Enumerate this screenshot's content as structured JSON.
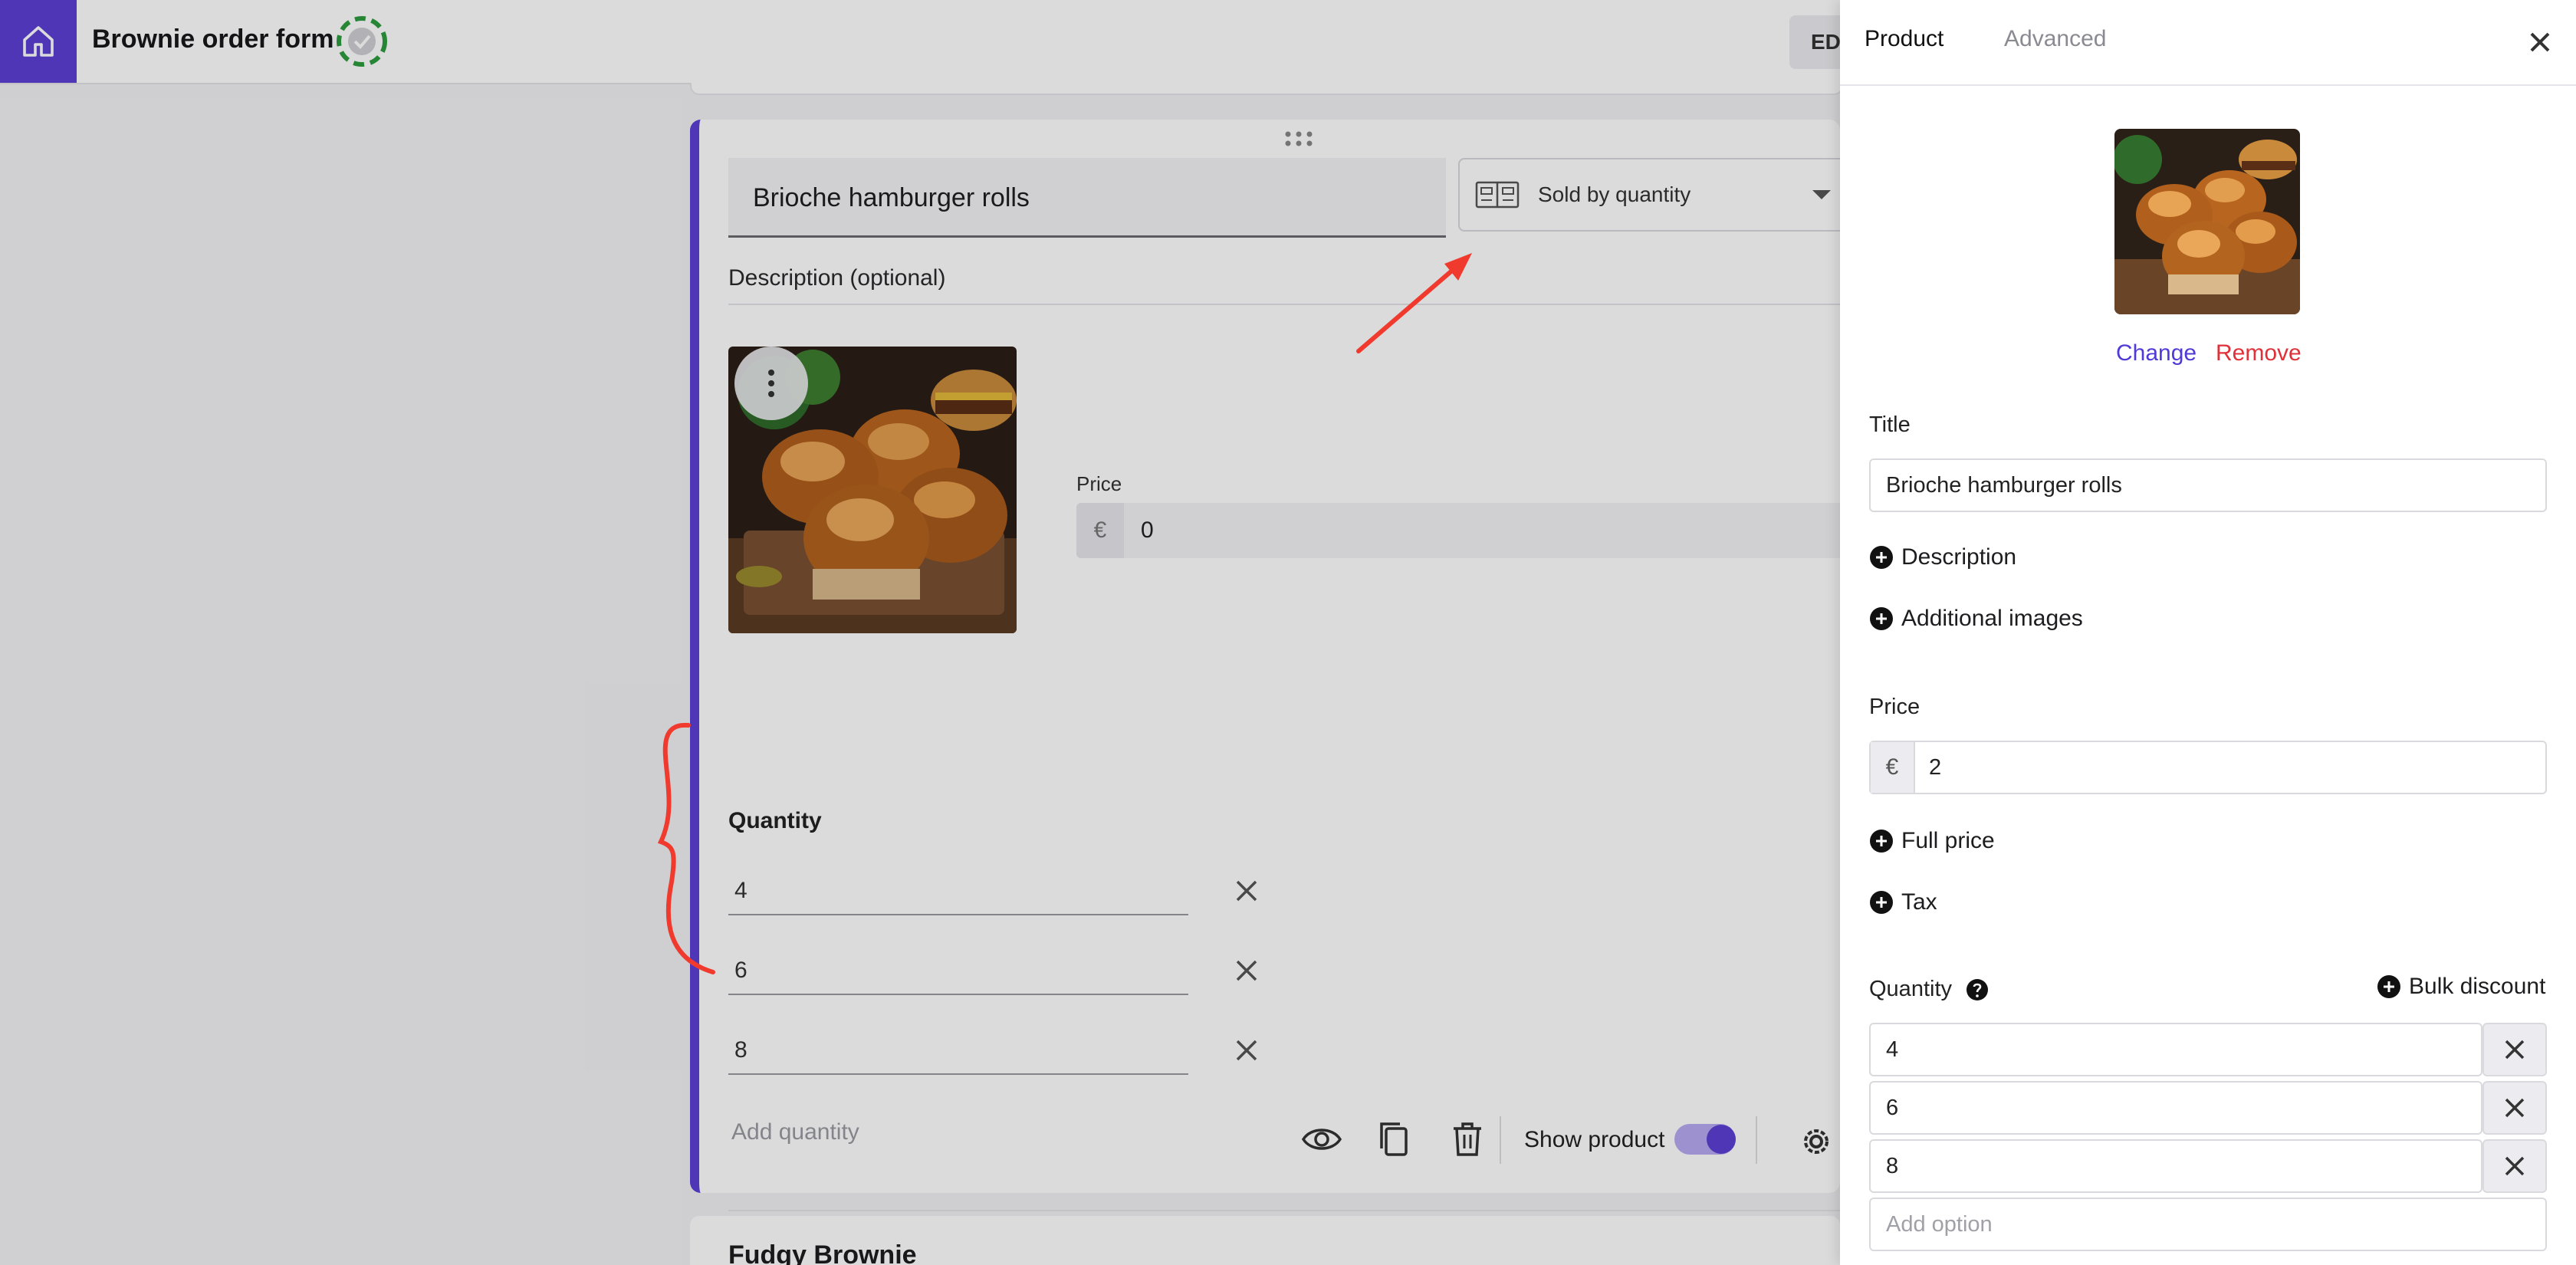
{
  "app": {
    "form_title": "Brownie order form",
    "edit_button_label": "EDI"
  },
  "product_card": {
    "title": "Brioche hamburger rolls",
    "sold_by": "Sold by quantity",
    "description_label": "Description (optional)",
    "price_label": "Price",
    "currency": "€",
    "price_value": "0",
    "quantity_label": "Quantity",
    "quantities": [
      "4",
      "6",
      "8"
    ],
    "add_quantity": "Add quantity",
    "show_product_label": "Show product",
    "show_product_on": true,
    "icons": [
      "drag-handle-icon",
      "kebab-menu-icon",
      "eye-icon",
      "copy-icon",
      "trash-icon",
      "settings-gear-icon"
    ]
  },
  "next_card": {
    "title": "Fudgy Brownie"
  },
  "panel": {
    "tabs": [
      {
        "label": "Product",
        "active": true
      },
      {
        "label": "Advanced",
        "active": false
      }
    ],
    "image_actions": {
      "change": "Change",
      "remove": "Remove"
    },
    "title_label": "Title",
    "title_value": "Brioche hamburger rolls",
    "add_description": "Description",
    "add_images": "Additional images",
    "price_label": "Price",
    "currency": "€",
    "price_value": "2",
    "add_full_price": "Full price",
    "add_tax": "Tax",
    "quantity_label": "Quantity",
    "bulk_discount": "Bulk discount",
    "quantities": [
      "4",
      "6",
      "8"
    ],
    "add_option_placeholder": "Add option"
  },
  "colors": {
    "accent": "#5b3fd6",
    "remove_red": "#e0313a",
    "annotation_red": "#f03a2e"
  }
}
